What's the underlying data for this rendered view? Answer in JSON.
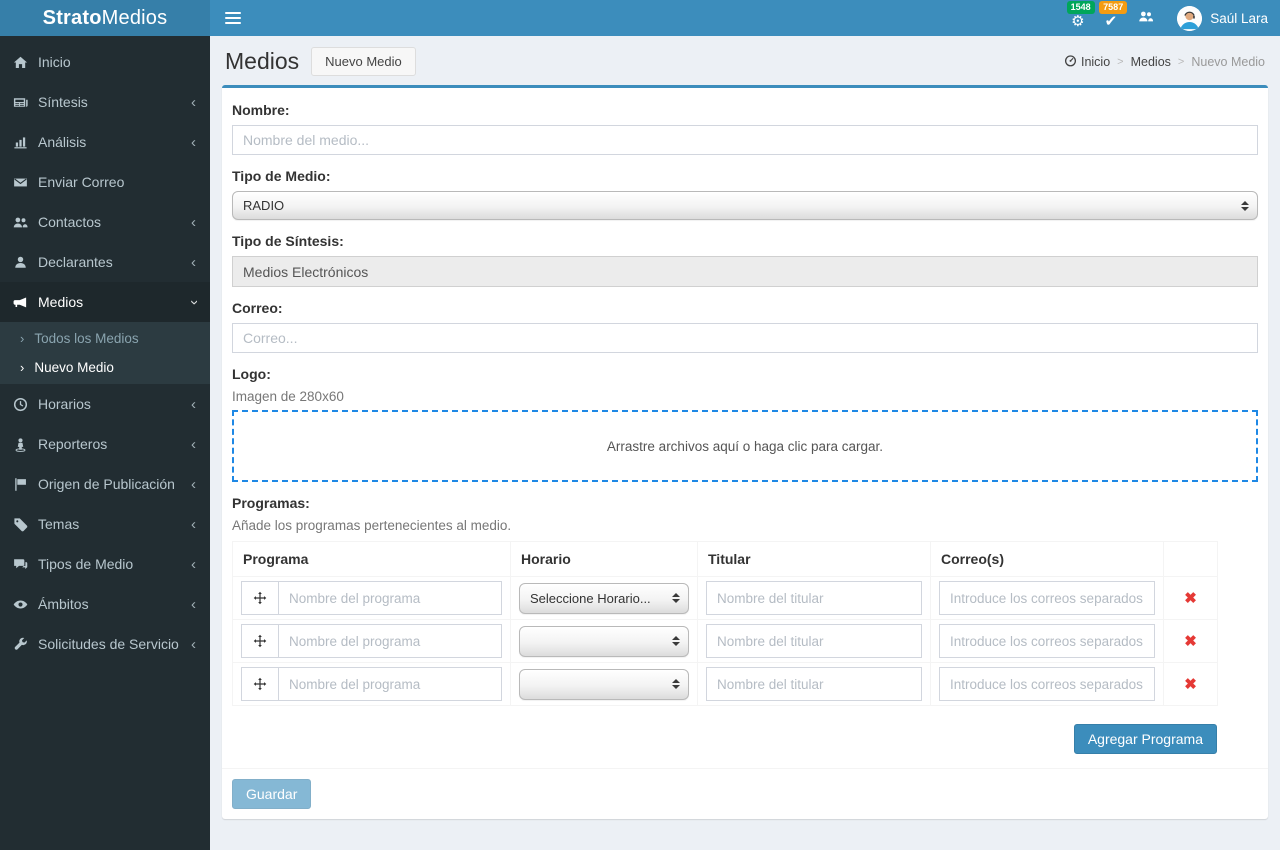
{
  "brand": {
    "bold": "Strato",
    "light": "Medios"
  },
  "topbar": {
    "notifications": [
      {
        "icon": "gear-icon",
        "glyph": "⚙",
        "count": "1548",
        "badge_color": "#00a65a"
      },
      {
        "icon": "check-icon",
        "glyph": "✔",
        "count": "7587",
        "badge_color": "#f39c12"
      }
    ],
    "user": {
      "name": "Saúl Lara"
    }
  },
  "sidebar": {
    "items": [
      {
        "icon": "home-icon",
        "label": "Inicio"
      },
      {
        "icon": "newspaper-icon",
        "label": "Síntesis",
        "chevron": "left"
      },
      {
        "icon": "bar-chart-icon",
        "label": "Análisis",
        "chevron": "left"
      },
      {
        "icon": "envelope-icon",
        "label": "Enviar Correo"
      },
      {
        "icon": "users-icon",
        "label": "Contactos",
        "chevron": "left"
      },
      {
        "icon": "user-icon",
        "label": "Declarantes",
        "chevron": "left"
      },
      {
        "icon": "megaphone-icon",
        "label": "Medios",
        "chevron": "down",
        "active": true,
        "children": [
          {
            "label": "Todos los Medios",
            "active": false
          },
          {
            "label": "Nuevo Medio",
            "active": true
          }
        ]
      },
      {
        "icon": "clock-icon",
        "label": "Horarios",
        "chevron": "left"
      },
      {
        "icon": "reporter-icon",
        "label": "Reporteros",
        "chevron": "left"
      },
      {
        "icon": "flag-icon",
        "label": "Origen de Publicación",
        "chevron": "left"
      },
      {
        "icon": "tags-icon",
        "label": "Temas",
        "chevron": "left"
      },
      {
        "icon": "comments-icon",
        "label": "Tipos de Medio",
        "chevron": "left"
      },
      {
        "icon": "eye-icon",
        "label": "Ámbitos",
        "chevron": "left"
      },
      {
        "icon": "wrench-icon",
        "label": "Solicitudes de Servicio",
        "chevron": "left"
      }
    ]
  },
  "header": {
    "title": "Medios",
    "action_button": "Nuevo Medio",
    "breadcrumb": {
      "items": [
        "Inicio",
        "Medios",
        "Nuevo Medio"
      ]
    }
  },
  "form": {
    "nombre": {
      "label": "Nombre:",
      "placeholder": "Nombre del medio..."
    },
    "tipo_medio": {
      "label": "Tipo de Medio:",
      "value": "RADIO"
    },
    "tipo_sintesis": {
      "label": "Tipo de Síntesis:",
      "value": "Medios Electrónicos"
    },
    "correo": {
      "label": "Correo:",
      "placeholder": "Correo..."
    },
    "logo": {
      "label": "Logo:",
      "hint": "Imagen de 280x60",
      "dropzone_text": "Arrastre archivos aquí o haga clic para cargar."
    },
    "programas": {
      "label": "Programas:",
      "hint": "Añade los programas pertenecientes al medio.",
      "headers": [
        "Programa",
        "Horario",
        "Titular",
        "Correo(s)"
      ],
      "rows": [
        {
          "programa_placeholder": "Nombre del programa",
          "horario_value": "Seleccione Horario...",
          "titular_placeholder": "Nombre del titular",
          "correos_placeholder": "Introduce los correos separados por coma"
        },
        {
          "programa_placeholder": "Nombre del programa",
          "horario_value": "",
          "titular_placeholder": "Nombre del titular",
          "correos_placeholder": "Introduce los correos separados por coma"
        },
        {
          "programa_placeholder": "Nombre del programa",
          "horario_value": "",
          "titular_placeholder": "Nombre del titular",
          "correos_placeholder": "Introduce los correos separados por coma"
        }
      ],
      "add_button": "Agregar Programa",
      "delete_glyph": "✖"
    },
    "save_button": "Guardar"
  },
  "colors": {
    "navbar": "#3c8dbc",
    "logo_bg": "#367fa9",
    "sidebar": "#222d32",
    "sidebar_active": "#1e282c",
    "submenu": "#2c3b41",
    "page_bg": "#ecf0f5",
    "accent": "#3c8dbc",
    "badge_green": "#00a65a",
    "badge_orange": "#f39c12",
    "dropzone_border": "#1e88e5",
    "delete_red": "#e53935"
  }
}
